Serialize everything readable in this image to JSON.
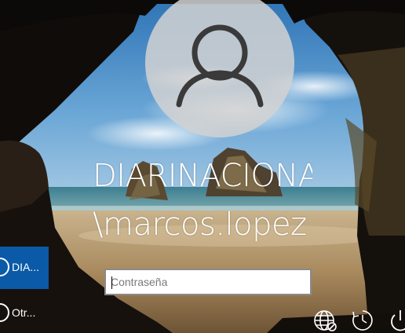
{
  "user_display": {
    "domain_line": "DIARINACIONAL",
    "account_line": "\\marcos.lopez"
  },
  "password_field": {
    "placeholder": "Contraseña",
    "value": ""
  },
  "user_list": [
    {
      "label": "DIA...",
      "selected": true
    },
    {
      "label": "Otr...",
      "selected": false
    }
  ],
  "system_icons": [
    "network-icon",
    "accessibility-icon",
    "power-icon"
  ],
  "colors": {
    "selected_tile": "#0a5aa8",
    "avatar_circle": "#d2d2d2",
    "text": "#ffffff"
  }
}
